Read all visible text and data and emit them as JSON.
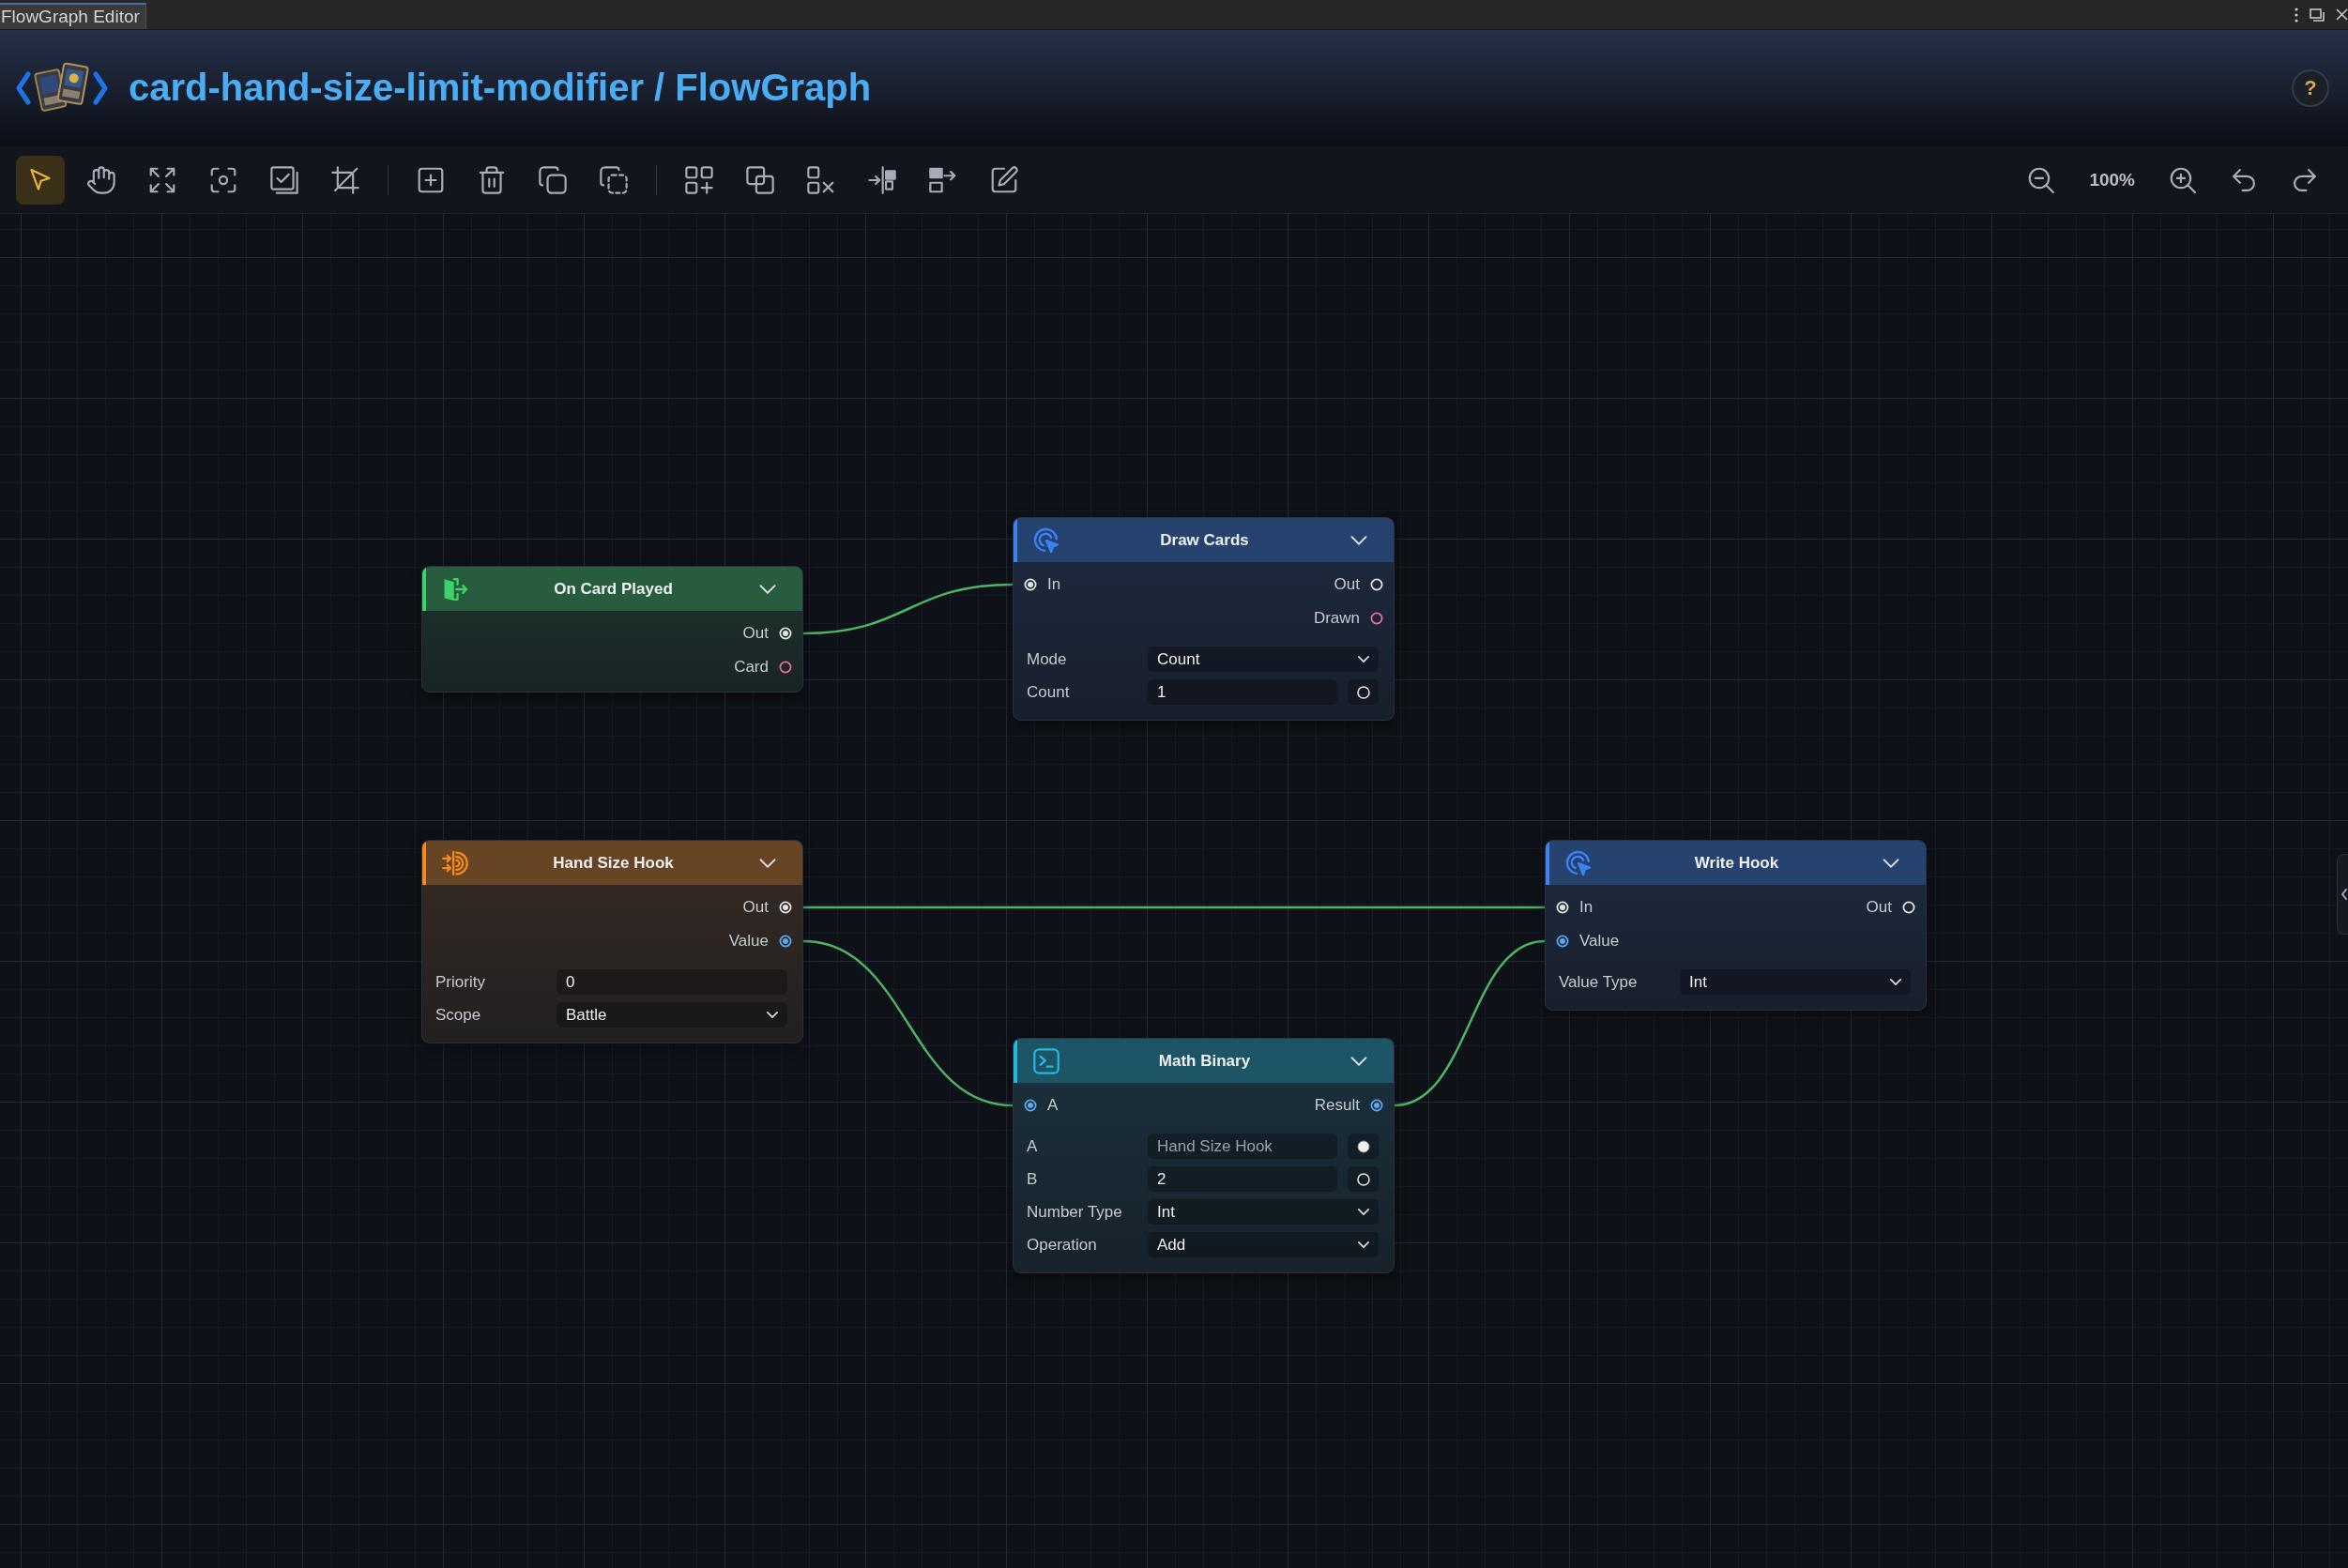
{
  "window": {
    "tab": "FlowGraph Editor"
  },
  "header": {
    "title": "card-hand-size-limit-modifier / FlowGraph",
    "help": "?"
  },
  "toolbar": {
    "groups": [
      {
        "tools": [
          {
            "selected": true
          },
          {
            "selected": false
          },
          {
            "selected": false
          },
          {
            "selected": false
          },
          {
            "selected": false
          },
          {
            "selected": false
          }
        ]
      },
      {
        "tools": [
          {
            "selected": false
          },
          {
            "selected": false
          },
          {
            "selected": false
          },
          {
            "selected": false
          }
        ]
      },
      {
        "tools": [
          {
            "selected": false
          },
          {
            "selected": false
          },
          {
            "selected": false
          },
          {
            "selected": false
          },
          {
            "selected": false
          },
          {
            "selected": false
          }
        ]
      }
    ],
    "zoom": "100%"
  },
  "nodes": [
    {
      "kind": "event",
      "color": "#3fd16a",
      "title": "On Card Played",
      "outputs": [
        {
          "label": "Out",
          "color": "#e4e4e4",
          "connected": true
        },
        {
          "label": "Card",
          "color": "#e86f9c",
          "connected": false
        }
      ]
    },
    {
      "kind": "action",
      "color": "#3b82f6",
      "title": "Draw Cards",
      "inputs": [
        {
          "label": "In",
          "color": "#e4e4e4",
          "connected": true
        }
      ],
      "outputs": [
        {
          "label": "Out",
          "color": "#e4e4e4",
          "connected": false
        },
        {
          "label": "Drawn",
          "color": "#e86f9c",
          "connected": false
        }
      ],
      "fields": [
        {
          "kind": "select",
          "label": "Mode",
          "value": "Count"
        },
        {
          "kind": "input",
          "label": "Count",
          "value": "1",
          "socket": {
            "connected": false
          }
        }
      ]
    },
    {
      "kind": "hook",
      "color": "#f58a1f",
      "title": "Hand Size Hook",
      "outputs": [
        {
          "label": "Out",
          "color": "#e4e4e4",
          "connected": true
        },
        {
          "label": "Value",
          "color": "#5aa8f0",
          "connected": true
        }
      ],
      "fields": [
        {
          "kind": "input",
          "label": "Priority",
          "value": "0"
        },
        {
          "kind": "select",
          "label": "Scope",
          "value": "Battle"
        }
      ]
    },
    {
      "kind": "action",
      "color": "#3b82f6",
      "title": "Write Hook",
      "inputs": [
        {
          "label": "In",
          "color": "#e4e4e4",
          "connected": true
        },
        {
          "label": "Value",
          "color": "#5aa8f0",
          "connected": true
        }
      ],
      "outputs": [
        {
          "label": "Out",
          "color": "#e4e4e4",
          "connected": false
        }
      ],
      "fields": [
        {
          "kind": "select",
          "label": "Value Type",
          "value": "Int"
        }
      ]
    },
    {
      "kind": "math",
      "color": "#22b8e0",
      "title": "Math Binary",
      "inputs": [
        {
          "label": "A",
          "color": "#5aa8f0",
          "connected": true
        }
      ],
      "outputs": [
        {
          "label": "Result",
          "color": "#5aa8f0",
          "connected": true
        }
      ],
      "fields": [
        {
          "kind": "input",
          "label": "A",
          "value": "Hand Size Hook",
          "socket": {
            "connected": true
          }
        },
        {
          "kind": "input",
          "label": "B",
          "value": "2",
          "socket": {
            "connected": false
          }
        },
        {
          "kind": "select",
          "label": "Number Type",
          "value": "Int"
        },
        {
          "kind": "select",
          "label": "Operation",
          "value": "Add"
        }
      ]
    }
  ]
}
